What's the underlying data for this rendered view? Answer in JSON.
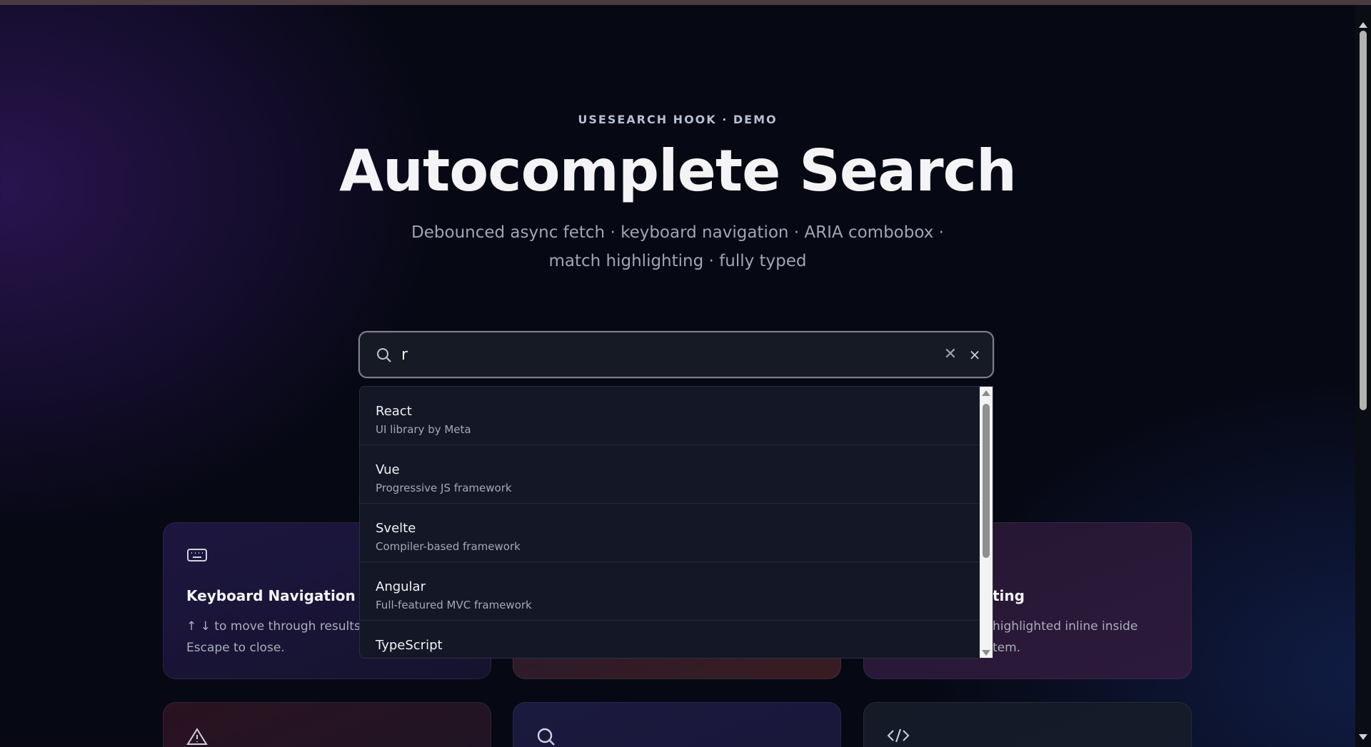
{
  "colors": {
    "background": "#060813",
    "accent_purple": "#461e82",
    "text_primary": "#f4f4f6",
    "text_muted": "#a0a5b4"
  },
  "header": {
    "eyebrow": "USESEARCH HOOK · DEMO",
    "title": "Autocomplete Search",
    "subtitle": "Debounced async fetch · keyboard navigation · ARIA combobox · match highlighting · fully typed"
  },
  "search": {
    "value": "r",
    "placeholder": "",
    "icon": "search-icon",
    "clear_label": "✕",
    "close_label": "×"
  },
  "results": [
    {
      "label": "React",
      "description": "UI library by Meta"
    },
    {
      "label": "Vue",
      "description": "Progressive JS framework"
    },
    {
      "label": "Svelte",
      "description": "Compiler-based framework"
    },
    {
      "label": "Angular",
      "description": "Full-featured MVC framework"
    },
    {
      "label": "TypeScript",
      "description": ""
    }
  ],
  "features": [
    {
      "icon": "keyboard-icon",
      "title": "Keyboard Navigation",
      "description": "↑ ↓ to move through results, E",
      "description_line2": "Escape to close."
    },
    {
      "icon": "",
      "title": "",
      "description": ""
    },
    {
      "icon": "",
      "title_fragment": "ting",
      "description_fragment": "highlighted inline inside",
      "description_fragment2": "tem."
    }
  ],
  "features_row2": [
    {
      "icon": "warning-icon"
    },
    {
      "icon": "search-icon"
    },
    {
      "icon": "code-icon"
    }
  ]
}
